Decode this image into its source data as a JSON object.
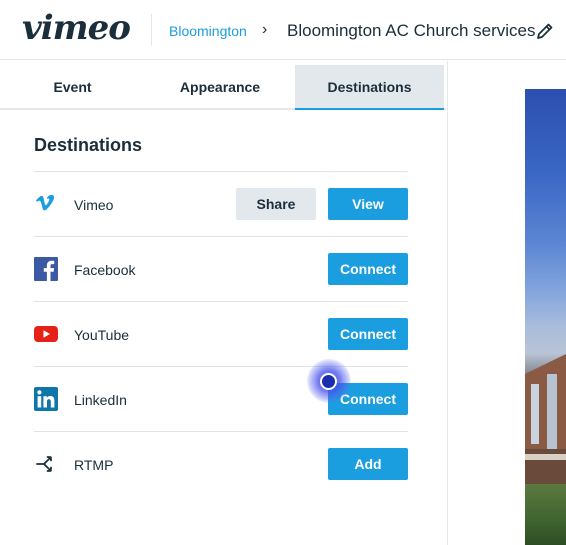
{
  "header": {
    "logo_text": "vimeo",
    "breadcrumb_parent": "Bloomington",
    "breadcrumb_separator": "›",
    "event_title": "Bloomington AC Church services",
    "edit_icon": "pencil-icon"
  },
  "tabs": [
    {
      "label": "Event",
      "active": false
    },
    {
      "label": "Appearance",
      "active": false
    },
    {
      "label": "Destinations",
      "active": true
    }
  ],
  "destinations": {
    "title": "Destinations",
    "items": [
      {
        "name": "Vimeo",
        "icon": "vimeo-icon",
        "secondary_button": "Share",
        "primary_button": "View"
      },
      {
        "name": "Facebook",
        "icon": "facebook-icon",
        "primary_button": "Connect"
      },
      {
        "name": "YouTube",
        "icon": "youtube-icon",
        "primary_button": "Connect"
      },
      {
        "name": "LinkedIn",
        "icon": "linkedin-icon",
        "primary_button": "Connect"
      },
      {
        "name": "RTMP",
        "icon": "rtmp-icon",
        "primary_button": "Add"
      }
    ]
  },
  "colors": {
    "accent": "#1a9ee0",
    "text": "#1a2e3b",
    "secondary_button_bg": "#e3e8ec",
    "facebook": "#1877f2",
    "youtube": "#ff0000",
    "linkedin": "#0a66c2"
  }
}
